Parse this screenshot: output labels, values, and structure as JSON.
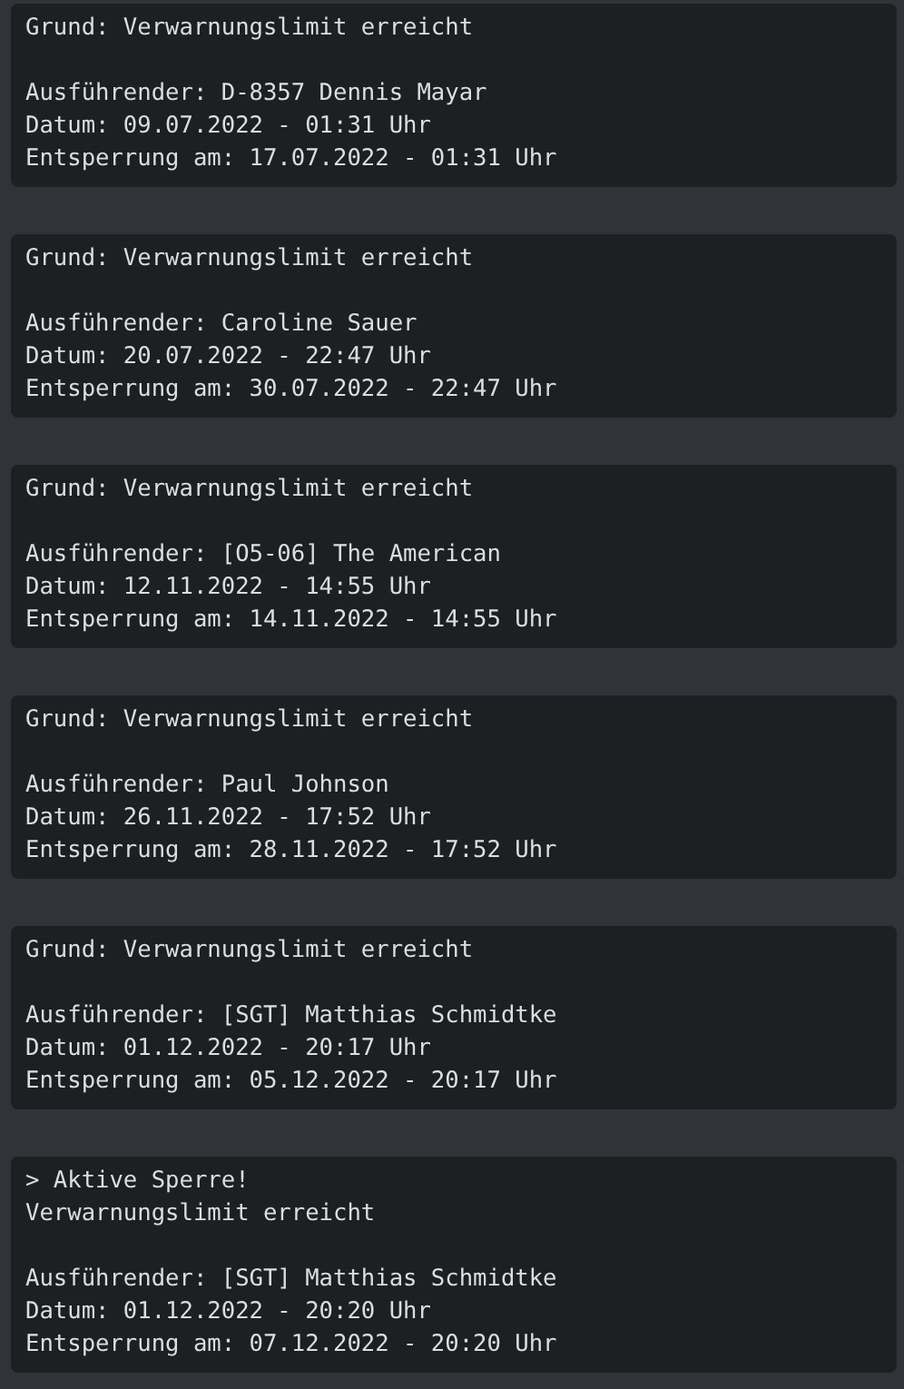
{
  "blocks": [
    {
      "header": [
        "Grund: Verwarnungslimit erreicht"
      ],
      "details": [
        "Ausführender: D-8357 Dennis Mayar",
        "Datum: 09.07.2022 - 01:31 Uhr",
        "Entsperrung am: 17.07.2022 - 01:31 Uhr"
      ]
    },
    {
      "header": [
        "Grund: Verwarnungslimit erreicht"
      ],
      "details": [
        "Ausführender: Caroline Sauer",
        "Datum: 20.07.2022 - 22:47 Uhr",
        "Entsperrung am: 30.07.2022 - 22:47 Uhr"
      ]
    },
    {
      "header": [
        "Grund: Verwarnungslimit erreicht"
      ],
      "details": [
        "Ausführender: [O5-06] The American",
        "Datum: 12.11.2022 - 14:55 Uhr",
        "Entsperrung am: 14.11.2022 - 14:55 Uhr"
      ]
    },
    {
      "header": [
        "Grund: Verwarnungslimit erreicht"
      ],
      "details": [
        "Ausführender: Paul Johnson",
        "Datum: 26.11.2022 - 17:52 Uhr",
        "Entsperrung am: 28.11.2022 - 17:52 Uhr"
      ]
    },
    {
      "header": [
        "Grund: Verwarnungslimit erreicht"
      ],
      "details": [
        "Ausführender: [SGT] Matthias Schmidtke",
        "Datum: 01.12.2022 - 20:17 Uhr",
        "Entsperrung am: 05.12.2022 - 20:17 Uhr"
      ]
    },
    {
      "header": [
        "> Aktive Sperre!",
        "Verwarnungslimit erreicht"
      ],
      "details": [
        "Ausführender: [SGT] Matthias Schmidtke",
        "Datum: 01.12.2022 - 20:20 Uhr",
        "Entsperrung am: 07.12.2022 - 20:20 Uhr"
      ]
    }
  ]
}
